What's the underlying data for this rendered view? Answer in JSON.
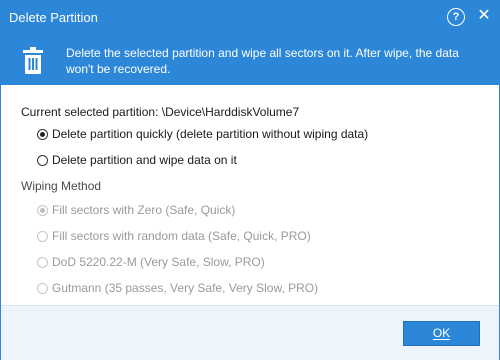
{
  "window": {
    "title": "Delete Partition",
    "help_label": "?",
    "close_label": "✕"
  },
  "banner": {
    "icon": "trash-icon",
    "message": "Delete the selected partition and wipe all sectors on it. After wipe, the data won't be recovered."
  },
  "partition": {
    "label": "Current selected partition:",
    "value": "\\Device\\HarddiskVolume7"
  },
  "delete_options": [
    {
      "label": "Delete partition quickly (delete partition without wiping data)",
      "selected": true,
      "enabled": true
    },
    {
      "label": "Delete partition and wipe data on it",
      "selected": false,
      "enabled": true
    }
  ],
  "wiping": {
    "label": "Wiping Method",
    "options": [
      {
        "label": "Fill sectors with Zero (Safe, Quick)",
        "selected": true,
        "enabled": false
      },
      {
        "label": "Fill sectors with random data (Safe, Quick, PRO)",
        "selected": false,
        "enabled": false
      },
      {
        "label": "DoD 5220.22-M (Very Safe, Slow, PRO)",
        "selected": false,
        "enabled": false
      },
      {
        "label": "Gutmann (35 passes, Very Safe, Very Slow, PRO)",
        "selected": false,
        "enabled": false
      }
    ]
  },
  "footer": {
    "ok_label": "OK"
  },
  "colors": {
    "accent": "#2d87d9",
    "footer_bg": "#eef4fb",
    "disabled_text": "#9a9a9a"
  }
}
